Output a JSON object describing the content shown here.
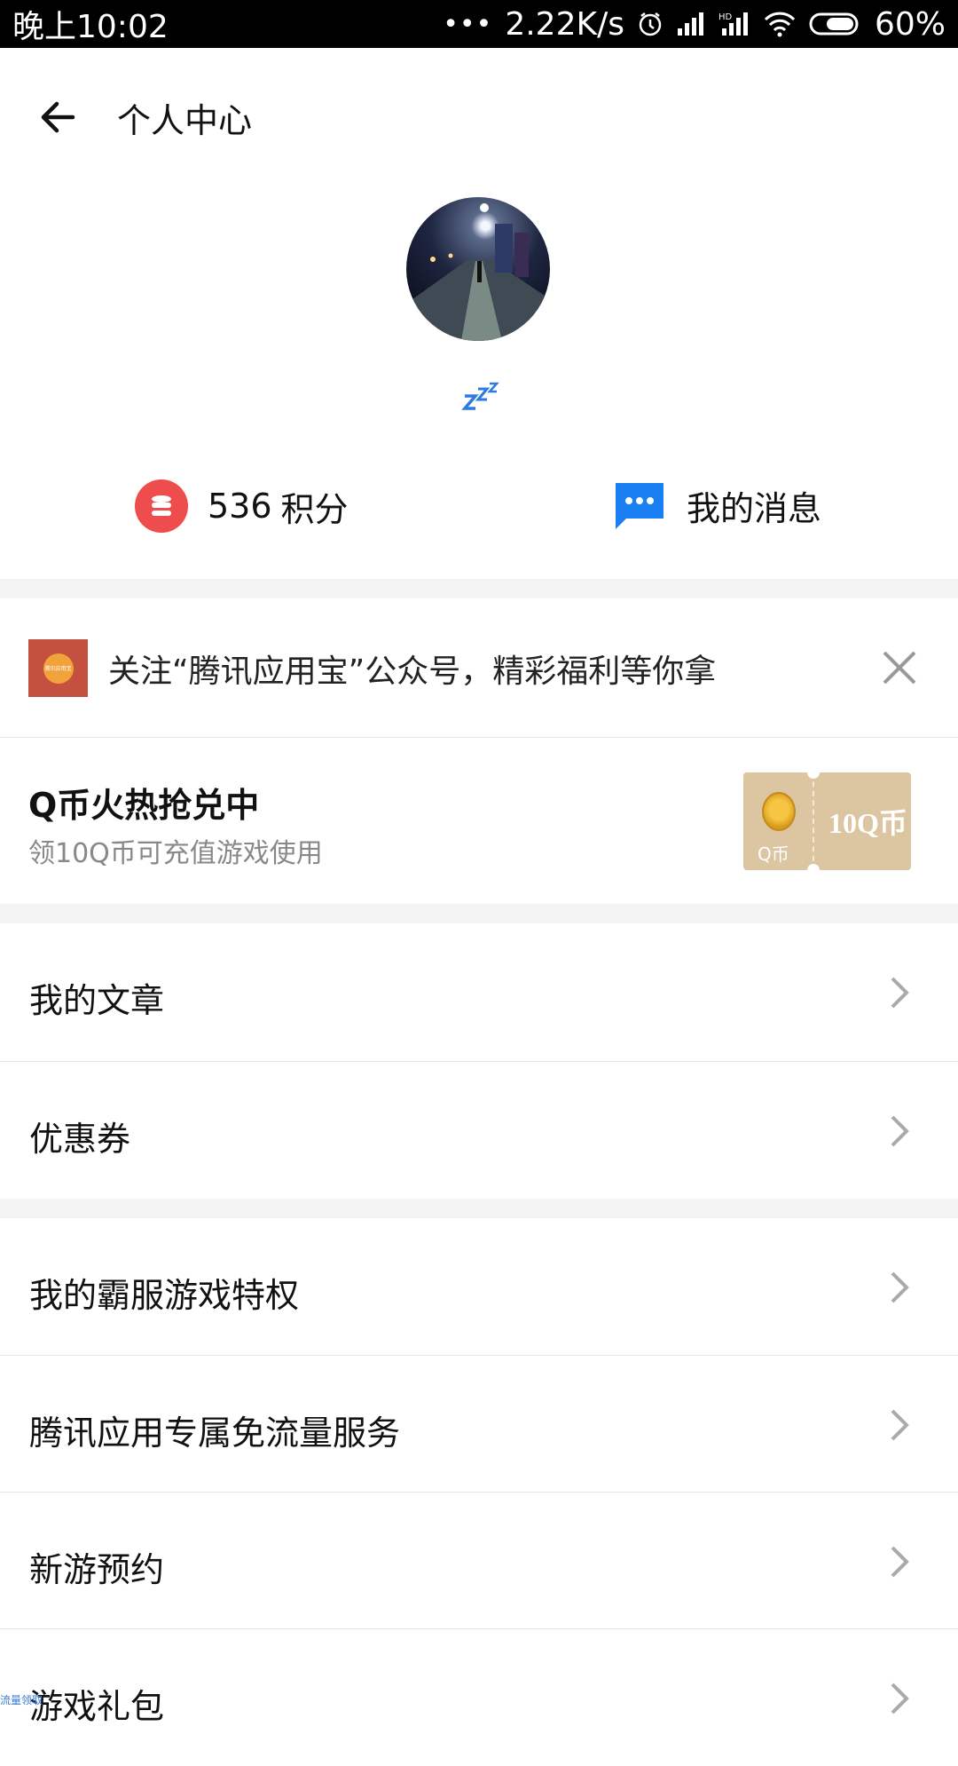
{
  "status_bar": {
    "time": "晚上10:02",
    "dots": "•••",
    "net_speed": "2.22K/s",
    "battery": "60%"
  },
  "header": {
    "title": "个人中心"
  },
  "profile": {
    "status_icon": "sleep-zzz-icon"
  },
  "stats": {
    "points_value": "536",
    "points_label": "积分",
    "messages_label": "我的消息"
  },
  "follow_banner": {
    "message": "关注“腾讯应用宝”公众号，精彩福利等你拿",
    "thumb_text": "腾讯应用宝"
  },
  "promo": {
    "title": "Q币火热抢兑中",
    "subtitle": "领10Q币可充值游戏使用",
    "ticket_label": "Q币",
    "ticket_amount": "10Q币"
  },
  "menu": {
    "items": [
      {
        "label": "我的文章"
      },
      {
        "label": "优惠券"
      },
      {
        "label": "我的霸服游戏特权"
      },
      {
        "label": "腾讯应用专属免流量服务"
      },
      {
        "label": "新游预约"
      },
      {
        "label": "游戏礼包"
      }
    ]
  },
  "footer": {
    "corner_text": "流量领取"
  },
  "colors": {
    "points_red": "#ef4d4d",
    "message_blue": "#1a7ff2",
    "ticket_gold": "#dcc6a2",
    "divider_gray": "#f3f3f3"
  }
}
